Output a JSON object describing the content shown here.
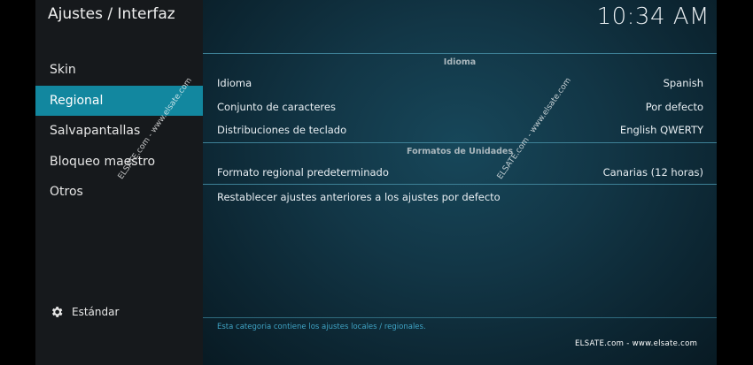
{
  "header": {
    "title": "Ajustes / Interfaz",
    "time": "10:34 AM"
  },
  "sidebar": {
    "items": [
      {
        "label": "Skin",
        "active": false
      },
      {
        "label": "Regional",
        "active": true
      },
      {
        "label": "Salvapantallas",
        "active": false
      },
      {
        "label": "Bloqueo maestro",
        "active": false
      },
      {
        "label": "Otros",
        "active": false
      }
    ],
    "level": {
      "icon": "gear-icon",
      "label": "Estándar"
    }
  },
  "settings": {
    "group_language": "Idioma",
    "idioma": {
      "label": "Idioma",
      "value": "Spanish"
    },
    "charset": {
      "label": "Conjunto de caracteres",
      "value": "Por defecto"
    },
    "keyboard": {
      "label": "Distribuciones de teclado",
      "value": "English QWERTY"
    },
    "group_units": "Formatos de Unidades",
    "region": {
      "label": "Formato regional predeterminado",
      "value": "Canarias (12 horas)"
    },
    "reset_label": "Restablecer ajustes anteriores a los ajustes por defecto"
  },
  "footer": {
    "description": "Esta categoria contiene los ajustes locales / regionales.",
    "brand": "ELSATE.com - www.elsate.com"
  },
  "watermarks": {
    "left": "ELSATE.com - www.elsate.com",
    "right": "ELSATE.com - www.elsate.com"
  },
  "colors": {
    "accent": "#12879f",
    "sidebar": "#16191c",
    "panel": "#123646"
  }
}
